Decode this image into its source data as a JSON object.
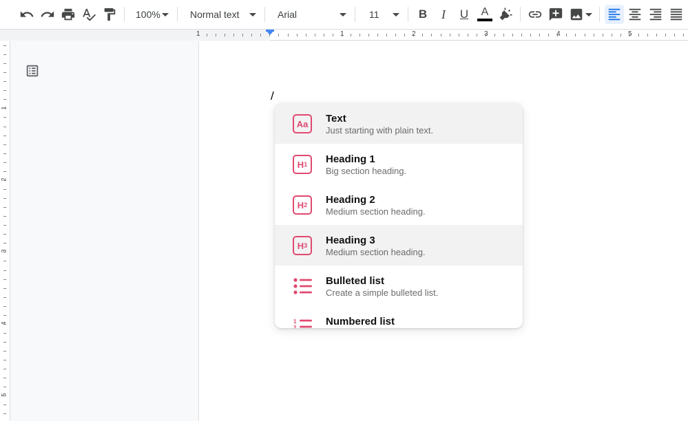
{
  "toolbar": {
    "zoom": "100%",
    "paragraph_style": "Normal text",
    "font_family": "Arial",
    "font_size": "11",
    "bold_label": "B",
    "italic_label": "I",
    "underline_label": "U",
    "text_color_label": "A",
    "text_color_bar": "#000000",
    "icons": [
      "undo-icon",
      "redo-icon",
      "print-icon",
      "spellcheck-icon",
      "paint-format-icon",
      "highlighter-icon",
      "link-icon",
      "add-comment-icon",
      "insert-image-icon",
      "align-left-icon",
      "align-center-icon",
      "align-right-icon",
      "justify-icon"
    ]
  },
  "ruler": {
    "numbers": [
      "1",
      "1",
      "2",
      "3",
      "4",
      "5"
    ]
  },
  "vruler": {
    "numbers": [
      "1",
      "2",
      "3",
      "4",
      "5"
    ]
  },
  "document": {
    "typed_text": "/"
  },
  "slash_menu": {
    "accent": "#e0486f",
    "items": [
      {
        "title": "Text",
        "description": "Just starting with plain text.",
        "icon": "text-icon",
        "icon_label": "Aa",
        "highlighted": true
      },
      {
        "title": "Heading 1",
        "description": "Big section heading.",
        "icon": "heading-1-icon",
        "icon_label": "H",
        "icon_sub": "1",
        "highlighted": false
      },
      {
        "title": "Heading 2",
        "description": "Medium section heading.",
        "icon": "heading-2-icon",
        "icon_label": "H",
        "icon_sub": "2",
        "highlighted": false
      },
      {
        "title": "Heading 3",
        "description": "Medium section heading.",
        "icon": "heading-3-icon",
        "icon_label": "H",
        "icon_sub": "3",
        "highlighted": true
      },
      {
        "title": "Bulleted list",
        "description": "Create a simple bulleted list.",
        "icon": "bulleted-list-icon",
        "highlighted": false
      },
      {
        "title": "Numbered list",
        "description": "",
        "icon": "numbered-list-icon",
        "highlighted": false
      }
    ]
  }
}
